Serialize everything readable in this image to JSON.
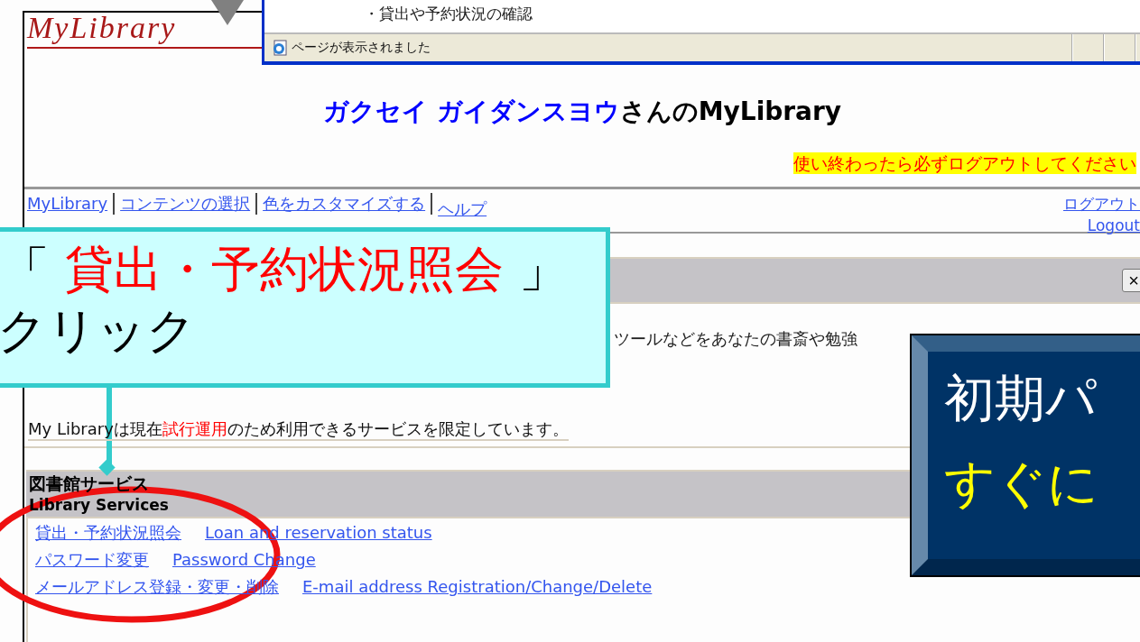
{
  "browser_window": {
    "content_line": "・貸出や予約状況の確認",
    "status_text": "ページが表示されました"
  },
  "logo": "MyLibrary",
  "heading": {
    "name": "ガクセイ ガイダンスヨウ",
    "suffix": "さんのMyLibrary"
  },
  "notice": "使い終わったら必ずログアウトしてください",
  "nav": {
    "links": [
      "MyLibrary",
      "コンテンツの選択",
      "色をカスタマイズする",
      "ヘルプ"
    ],
    "logout": [
      "ログアウト",
      "Logout"
    ]
  },
  "panel": {
    "close_label": "×",
    "intro": "ツールなどをあなたの書斎や勉強",
    "message": [
      {
        "text": "My Libraryは現在",
        "highlight": false
      },
      {
        "text": "試行運用",
        "highlight": true
      },
      {
        "text": "のため利用できるサービスを限定しています。",
        "highlight": false
      }
    ]
  },
  "services": {
    "title": "図書館サービス",
    "subtitle": "Library Services",
    "links": [
      {
        "ja": "貸出・予約状況照会",
        "en": "Loan and reservation status"
      },
      {
        "ja": "パスワード変更",
        "en": "Password Change"
      },
      {
        "ja": "メールアドレス登録・変更・削除",
        "en": "E-mail address Registration/Change/Delete"
      }
    ]
  },
  "callout": {
    "open": "「",
    "target": "貸出・予約状況照会",
    "close": "」",
    "action": "クリック"
  },
  "note_box": {
    "line_1": "初期パ",
    "line_2": "すぐに"
  }
}
